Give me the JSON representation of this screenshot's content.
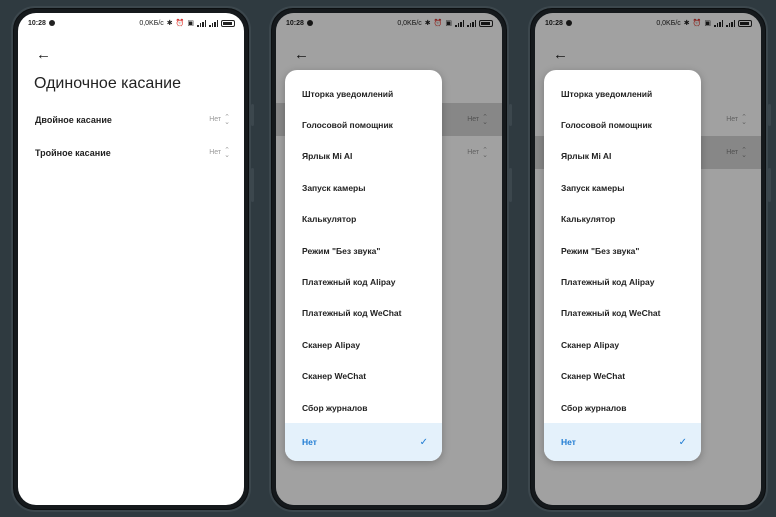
{
  "status_bar": {
    "time": "10:28",
    "speed": "0,0KБ/с",
    "battery": "38"
  },
  "settings_page": {
    "title": "Одиночное касание",
    "rows": [
      {
        "label": "Двойное касание",
        "value": "Нет"
      },
      {
        "label": "Тройное касание",
        "value": "Нет"
      }
    ]
  },
  "dropdown": {
    "options": [
      "Шторка уведомлений",
      "Голосовой помощник",
      "Ярлык Mi AI",
      "Запуск камеры",
      "Калькулятор",
      "Режим \"Без звука\"",
      "Платежный код Alipay",
      "Платежный код WeChat",
      "Сканер Alipay",
      "Сканер WeChat",
      "Сбор журналов"
    ],
    "selected": "Нет"
  },
  "colors": {
    "accent": "#1f7cd3",
    "selected_bg": "#e4f1fb",
    "background": "#2f3a40"
  },
  "icons": {
    "back": "arrow-left-icon",
    "check": "checkmark-icon",
    "updown": "chevron-updown-icon"
  }
}
